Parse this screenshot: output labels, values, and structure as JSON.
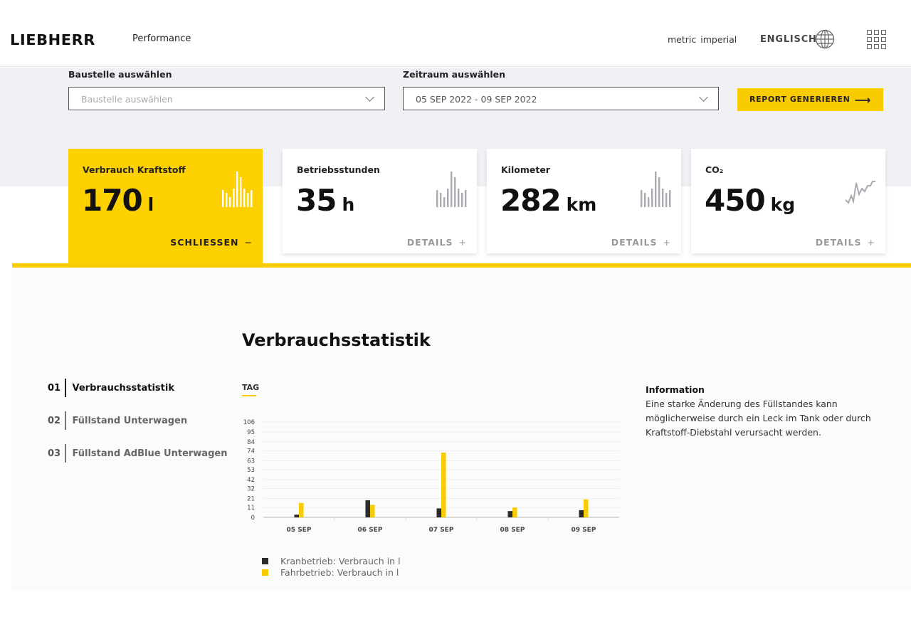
{
  "header": {
    "brand": "LIEBHERR",
    "app_name": "Performance",
    "units": [
      "metric",
      "imperial"
    ],
    "language": "ENGLISCH",
    "icons": {
      "language": "globe-icon",
      "apps": "app-grid-icon"
    }
  },
  "filters": {
    "site": {
      "label": "Baustelle auswählen",
      "value": "",
      "placeholder": "Baustelle auswählen"
    },
    "period": {
      "label": "Zeitraum auswählen",
      "value": "05 SEP 2022 - 09 SEP 2022"
    },
    "report_button": {
      "label": "REPORT GENERIEREN",
      "icon": "arrow-right-icon"
    }
  },
  "cards": [
    {
      "title": "Verbrauch Kraftstoff",
      "value": "170",
      "unit": "l",
      "action": "SCHLIESSEN",
      "action_symbol": "−",
      "active": true,
      "spark_type": "bars"
    },
    {
      "title": "Betriebsstunden",
      "value": "35",
      "unit": "h",
      "action": "DETAILS",
      "action_symbol": "+",
      "active": false,
      "spark_type": "bars"
    },
    {
      "title": "Kilometer",
      "value": "282",
      "unit": "km",
      "action": "DETAILS",
      "action_symbol": "+",
      "active": false,
      "spark_type": "bars"
    },
    {
      "title": "CO₂",
      "value": "450",
      "unit": "kg",
      "action": "DETAILS",
      "action_symbol": "+",
      "active": false,
      "spark_type": "line"
    }
  ],
  "section": {
    "title": "Verbrauchsstatistik",
    "nav": [
      {
        "num": "01",
        "label": "Verbrauchsstatistik",
        "active": true
      },
      {
        "num": "02",
        "label": "Füllstand Unterwagen",
        "active": false
      },
      {
        "num": "03",
        "label": "Füllstand AdBlue Unterwagen",
        "active": false
      }
    ],
    "tab": "TAG",
    "info": {
      "title": "Information",
      "text": "Eine starke Änderung des Füllstandes kann möglicherweise durch ein Leck im Tank oder durch Kraftstoff-Diebstahl verursacht werden."
    }
  },
  "colors": {
    "accent": "#f8cc00",
    "kran": "#2b2b2b",
    "fahr": "#f8cc00",
    "grid": "#eeeeee"
  },
  "chart_data": {
    "type": "bar",
    "title": "",
    "xlabel": "",
    "ylabel": "",
    "categories": [
      "05 SEP",
      "06 SEP",
      "07 SEP",
      "08 SEP",
      "09 SEP"
    ],
    "series": [
      {
        "name": "Kranbetrieb: Verbrauch in l",
        "values": [
          3,
          19,
          10,
          7,
          8
        ]
      },
      {
        "name": "Fahrbetrieb: Verbrauch in l",
        "values": [
          16,
          14,
          72,
          11,
          20
        ]
      }
    ],
    "yticks": [
      0,
      11,
      21,
      32,
      42,
      53,
      63,
      74,
      84,
      95,
      106
    ],
    "ylim": [
      0,
      106
    ],
    "grid": true,
    "legend": "bottom-left"
  }
}
